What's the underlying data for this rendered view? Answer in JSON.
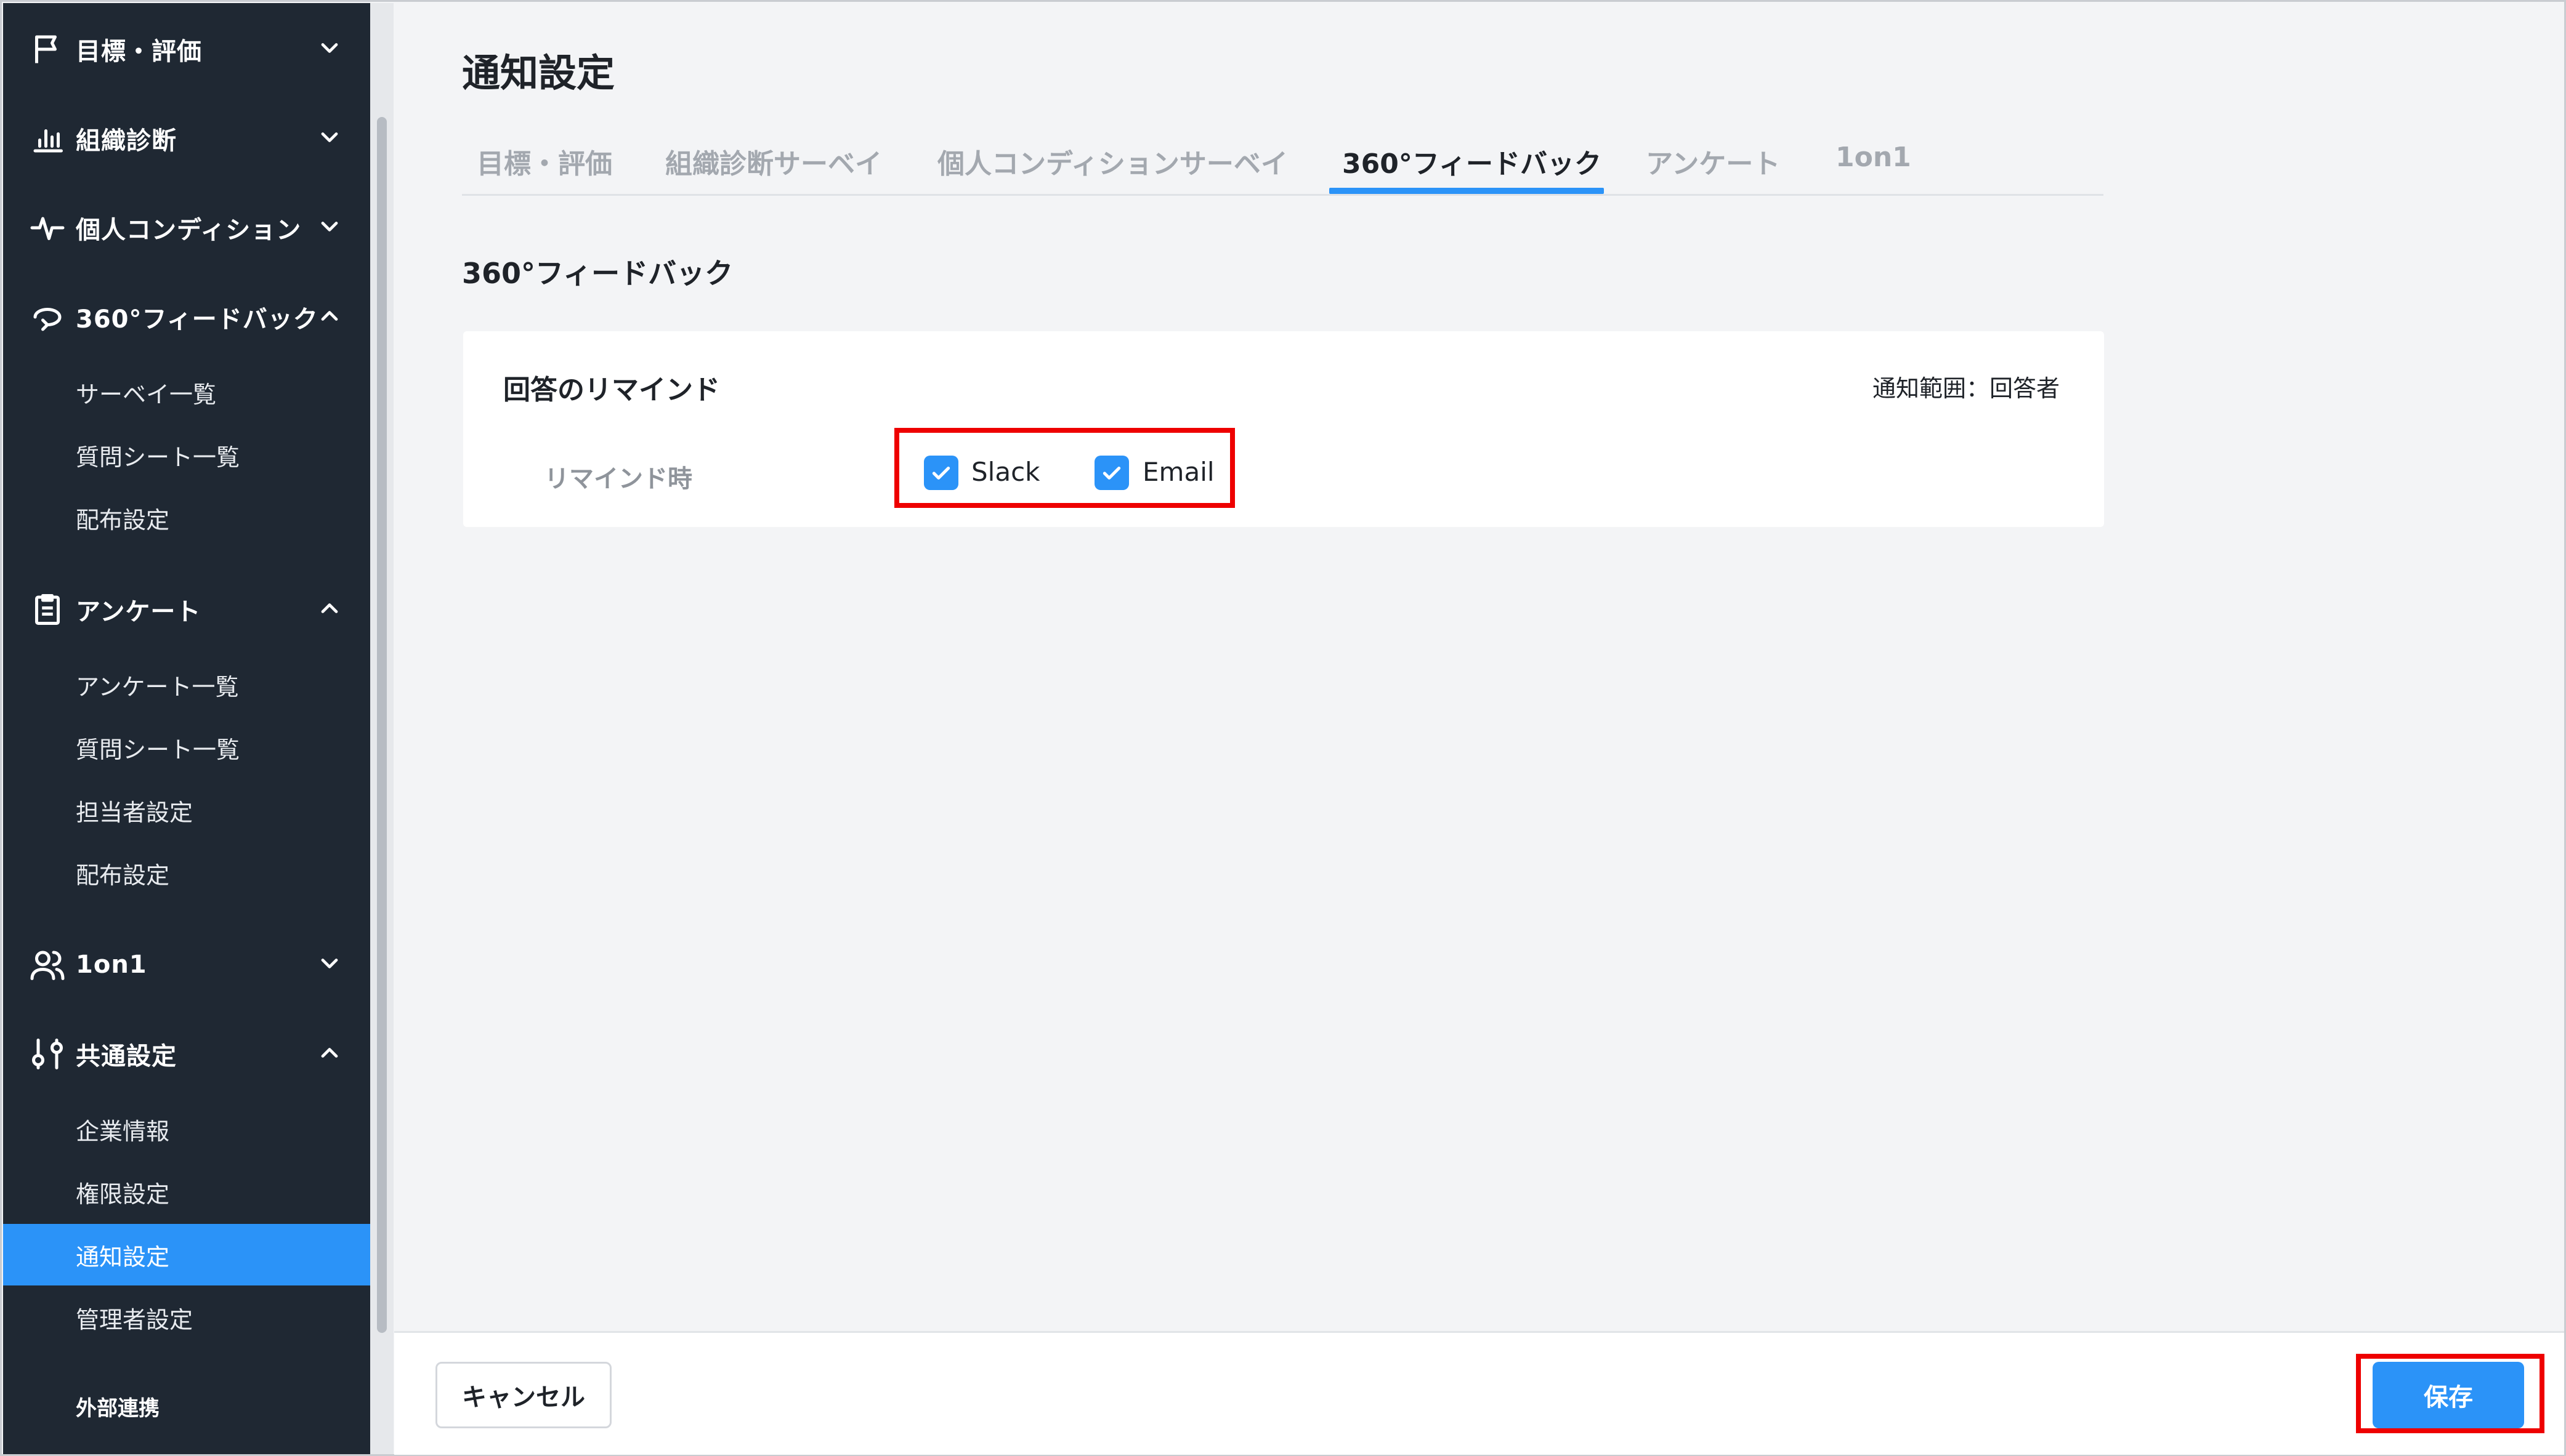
{
  "sidebar": {
    "sections": [
      {
        "label": "目標・評価",
        "icon": "flag-icon",
        "expanded": false
      },
      {
        "label": "組織診断",
        "icon": "bar-chart-icon",
        "expanded": false
      },
      {
        "label": "個人コンディション",
        "icon": "pulse-icon",
        "expanded": false
      },
      {
        "label": "360°フィードバック",
        "icon": "feedback-loop-icon",
        "expanded": true,
        "items": [
          "サーベイ一覧",
          "質問シート一覧",
          "配布設定"
        ]
      },
      {
        "label": "アンケート",
        "icon": "clipboard-icon",
        "expanded": true,
        "items": [
          "アンケート一覧",
          "質問シート一覧",
          "担当者設定",
          "配布設定"
        ]
      },
      {
        "label": "1on1",
        "icon": "users-icon",
        "expanded": false
      },
      {
        "label": "共通設定",
        "icon": "sliders-icon",
        "expanded": true,
        "items": [
          "企業情報",
          "権限設定",
          "通知設定",
          "管理者設定"
        ]
      }
    ],
    "active_item": "通知設定",
    "external_label": "外部連携"
  },
  "page": {
    "title": "通知設定",
    "tabs": [
      "目標・評価",
      "組織診断サーベイ",
      "個人コンディションサーベイ",
      "360°フィードバック",
      "アンケート",
      "1on1"
    ],
    "active_tab": "360°フィードバック",
    "section_title": "360°フィードバック"
  },
  "card": {
    "title": "回答のリマインド",
    "scope": "通知範囲：回答者",
    "row_label": "リマインド時",
    "options": [
      {
        "label": "Slack",
        "checked": true
      },
      {
        "label": "Email",
        "checked": true
      }
    ]
  },
  "footer": {
    "cancel_label": "キャンセル",
    "save_label": "保存"
  },
  "colors": {
    "sidebar_bg": "#1f2833",
    "accent": "#2b93f8",
    "highlight": "#ee0000",
    "page_bg": "#f3f4f6"
  }
}
